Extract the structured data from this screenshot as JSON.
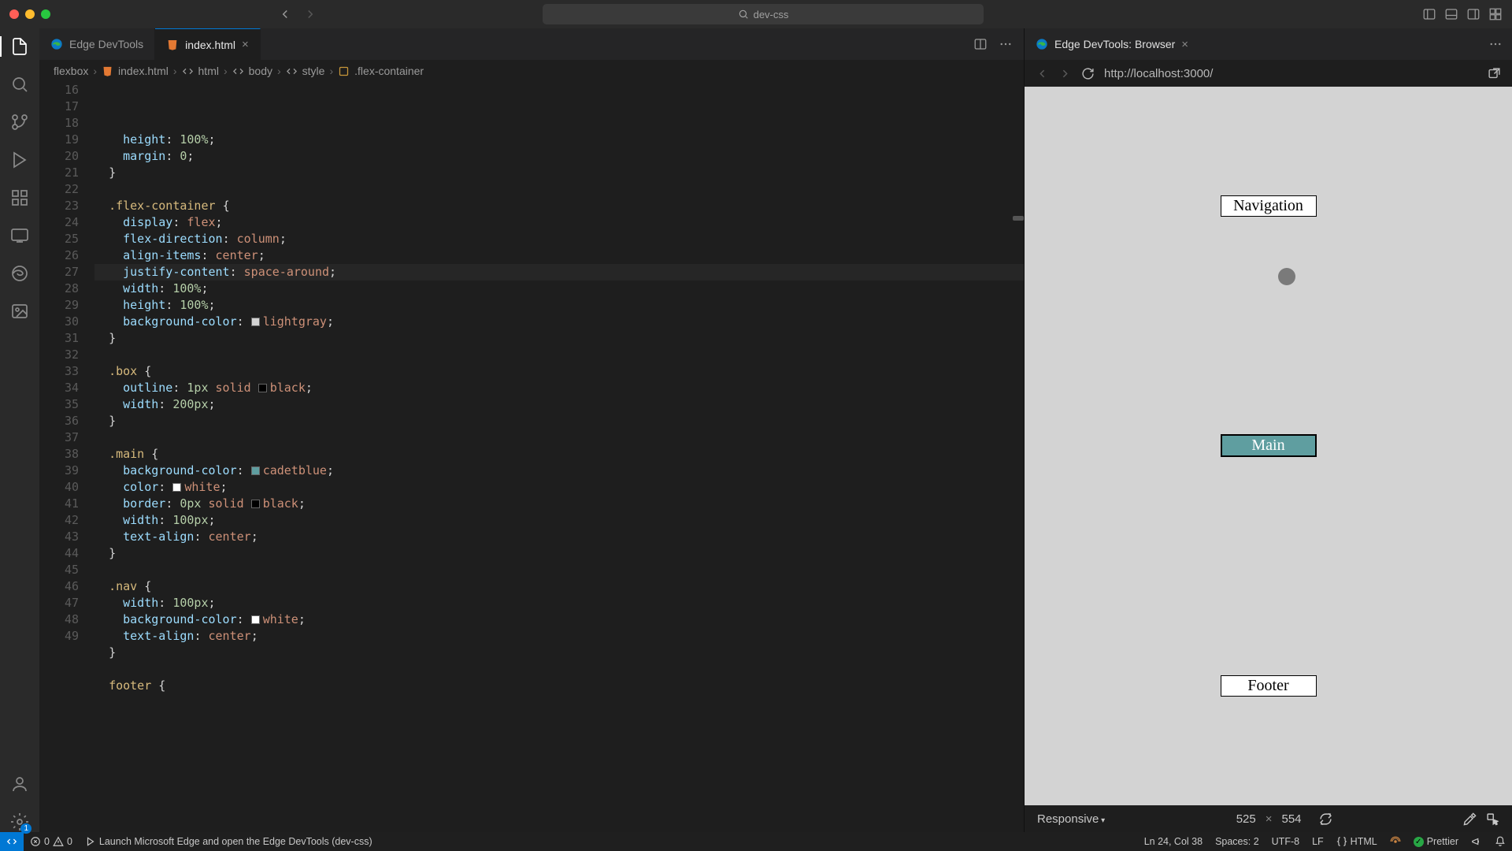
{
  "titlebar": {
    "search": "dev-css"
  },
  "tabs": {
    "devtools": "Edge DevTools",
    "file": "index.html",
    "browser": "Edge DevTools: Browser"
  },
  "breadcrumb": {
    "folder": "flexbox",
    "file": "index.html",
    "html": "html",
    "body": "body",
    "style": "style",
    "selector": ".flex-container"
  },
  "code_lines": [
    {
      "n": 16,
      "html": "    <span class='tok-prop'>height</span><span class='tok-punc'>:</span> <span class='tok-num'>100%</span><span class='tok-punc'>;</span>"
    },
    {
      "n": 17,
      "html": "    <span class='tok-prop'>margin</span><span class='tok-punc'>:</span> <span class='tok-num'>0</span><span class='tok-punc'>;</span>"
    },
    {
      "n": 18,
      "html": "  <span class='tok-punc'>}</span>"
    },
    {
      "n": 19,
      "html": ""
    },
    {
      "n": 20,
      "html": "  <span class='tok-sel'>.flex-container</span> <span class='tok-punc'>{</span>"
    },
    {
      "n": 21,
      "html": "    <span class='tok-prop'>display</span><span class='tok-punc'>:</span> <span class='tok-val'>flex</span><span class='tok-punc'>;</span>"
    },
    {
      "n": 22,
      "html": "    <span class='tok-prop'>flex-direction</span><span class='tok-punc'>:</span> <span class='tok-val'>column</span><span class='tok-punc'>;</span>"
    },
    {
      "n": 23,
      "html": "    <span class='tok-prop'>align-items</span><span class='tok-punc'>:</span> <span class='tok-val'>center</span><span class='tok-punc'>;</span>"
    },
    {
      "n": 24,
      "hl": true,
      "html": "    <span class='tok-prop'>justify-content</span><span class='tok-punc'>:</span> <span class='tok-val'>space-around</span><span class='tok-punc'>;</span>"
    },
    {
      "n": 25,
      "html": "    <span class='tok-prop'>width</span><span class='tok-punc'>:</span> <span class='tok-num'>100%</span><span class='tok-punc'>;</span>"
    },
    {
      "n": 26,
      "html": "    <span class='tok-prop'>height</span><span class='tok-punc'>:</span> <span class='tok-num'>100%</span><span class='tok-punc'>;</span>"
    },
    {
      "n": 27,
      "html": "    <span class='tok-prop'>background-color</span><span class='tok-punc'>:</span> <span class='swatch' style='background:#d3d3d3'></span><span class='tok-val'>lightgray</span><span class='tok-punc'>;</span>"
    },
    {
      "n": 28,
      "html": "  <span class='tok-punc'>}</span>"
    },
    {
      "n": 29,
      "html": ""
    },
    {
      "n": 30,
      "html": "  <span class='tok-sel'>.box</span> <span class='tok-punc'>{</span>"
    },
    {
      "n": 31,
      "html": "    <span class='tok-prop'>outline</span><span class='tok-punc'>:</span> <span class='tok-num'>1px</span> <span class='tok-val'>solid</span> <span class='swatch' style='background:#000'></span><span class='tok-val'>black</span><span class='tok-punc'>;</span>"
    },
    {
      "n": 32,
      "html": "    <span class='tok-prop'>width</span><span class='tok-punc'>:</span> <span class='tok-num'>200px</span><span class='tok-punc'>;</span>"
    },
    {
      "n": 33,
      "html": "  <span class='tok-punc'>}</span>"
    },
    {
      "n": 34,
      "html": ""
    },
    {
      "n": 35,
      "html": "  <span class='tok-sel'>.main</span> <span class='tok-punc'>{</span>"
    },
    {
      "n": 36,
      "html": "    <span class='tok-prop'>background-color</span><span class='tok-punc'>:</span> <span class='swatch' style='background:#5f9ea0'></span><span class='tok-val'>cadetblue</span><span class='tok-punc'>;</span>"
    },
    {
      "n": 37,
      "html": "    <span class='tok-prop'>color</span><span class='tok-punc'>:</span> <span class='swatch' style='background:#fff'></span><span class='tok-val'>white</span><span class='tok-punc'>;</span>"
    },
    {
      "n": 38,
      "html": "    <span class='tok-prop'>border</span><span class='tok-punc'>:</span> <span class='tok-num'>0px</span> <span class='tok-val'>solid</span> <span class='swatch' style='background:#000'></span><span class='tok-val'>black</span><span class='tok-punc'>;</span>"
    },
    {
      "n": 39,
      "html": "    <span class='tok-prop'>width</span><span class='tok-punc'>:</span> <span class='tok-num'>100px</span><span class='tok-punc'>;</span>"
    },
    {
      "n": 40,
      "html": "    <span class='tok-prop'>text-align</span><span class='tok-punc'>:</span> <span class='tok-val'>center</span><span class='tok-punc'>;</span>"
    },
    {
      "n": 41,
      "html": "  <span class='tok-punc'>}</span>"
    },
    {
      "n": 42,
      "html": ""
    },
    {
      "n": 43,
      "html": "  <span class='tok-sel'>.nav</span> <span class='tok-punc'>{</span>"
    },
    {
      "n": 44,
      "html": "    <span class='tok-prop'>width</span><span class='tok-punc'>:</span> <span class='tok-num'>100px</span><span class='tok-punc'>;</span>"
    },
    {
      "n": 45,
      "html": "    <span class='tok-prop'>background-color</span><span class='tok-punc'>:</span> <span class='swatch' style='background:#fff'></span><span class='tok-val'>white</span><span class='tok-punc'>;</span>"
    },
    {
      "n": 46,
      "html": "    <span class='tok-prop'>text-align</span><span class='tok-punc'>:</span> <span class='tok-val'>center</span><span class='tok-punc'>;</span>"
    },
    {
      "n": 47,
      "html": "  <span class='tok-punc'>}</span>"
    },
    {
      "n": 48,
      "html": ""
    },
    {
      "n": 49,
      "html": "  <span class='tok-sel'>footer</span> <span class='tok-punc'>{</span>"
    }
  ],
  "browser": {
    "url": "http://localhost:3000/",
    "nav": "Navigation",
    "main": "Main",
    "footer": "Footer",
    "responsive": "Responsive",
    "w": "525",
    "h": "554"
  },
  "status": {
    "errors": "0",
    "warnings": "0",
    "launch": "Launch Microsoft Edge and open the Edge DevTools (dev-css)",
    "cursor": "Ln 24, Col 38",
    "spaces": "Spaces: 2",
    "encoding": "UTF-8",
    "eol": "LF",
    "lang": "HTML",
    "prettier": "Prettier",
    "settings_badge": "1"
  }
}
